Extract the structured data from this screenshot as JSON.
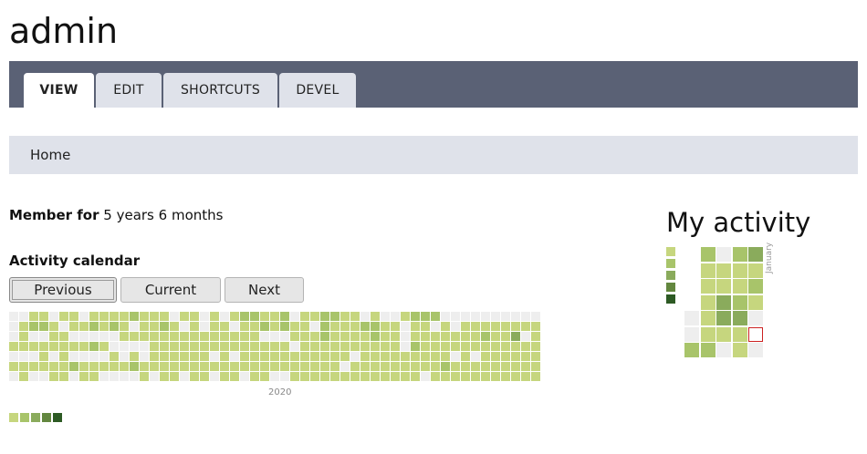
{
  "site": {
    "title": "admin"
  },
  "tabs": [
    {
      "label": "VIEW",
      "active": true
    },
    {
      "label": "EDIT",
      "active": false
    },
    {
      "label": "SHORTCUTS",
      "active": false
    },
    {
      "label": "DEVEL",
      "active": false
    }
  ],
  "breadcrumb": {
    "home": "Home"
  },
  "member": {
    "label": "Member for",
    "value": "5 years 6 months"
  },
  "calendar": {
    "title": "Activity calendar",
    "buttons": {
      "previous": "Previous",
      "current": "Current",
      "next": "Next"
    },
    "year_label": "2020",
    "colors": [
      "#eeeeee",
      "#c6d67e",
      "#a8c46a",
      "#8aab5c",
      "#63873f",
      "#2d5a24"
    ],
    "legend_levels": [
      1,
      2,
      3,
      4,
      5
    ],
    "grid": [
      "0011011011112111011010122112011221101001222000000000000011001112111211111011111111111501111111111111111111111211111111111111111111111",
      "0122101121210112101011011212110211122110110101111111101000112111211115120101000102111111111001111111111111211001122111221125111111105",
      "0100110000011111111111111000111211112110111111121130112111111011101111111111101211101121141102211111211000011111112211111111112111005",
      "1111111121000011111111111111011111111110211111111111111111111120211111111111100111111111111111011111211311111111111131111111111111111",
      "0001010000101011111101011111111111011111111101011111111111111111111111111111111011110111221111111121111111110112111111111111111111111",
      "1111112111112111111111111111111110111111111211111111111111111111112111111111111111212111111112111111111111111111111112011211111111110",
      "0100110110000101101101101100111111111111101111111111111111115121111111111111111111111111111011111111111111111111111111111151111000000"
    ]
  },
  "sidebar": {
    "title": "My activity",
    "month_label": "January",
    "legend_levels": [
      1,
      2,
      3,
      4,
      5
    ],
    "weeks": [
      [
        null,
        null,
        null,
        null,
        0,
        0,
        2
      ],
      [
        2,
        1,
        1,
        1,
        1,
        1,
        2
      ],
      [
        0,
        1,
        1,
        3,
        3,
        1,
        0
      ],
      [
        2,
        1,
        1,
        2,
        3,
        1,
        1
      ],
      [
        3,
        1,
        2,
        1,
        0,
        0,
        0
      ]
    ],
    "today": {
      "week": 4,
      "day": 5
    }
  }
}
